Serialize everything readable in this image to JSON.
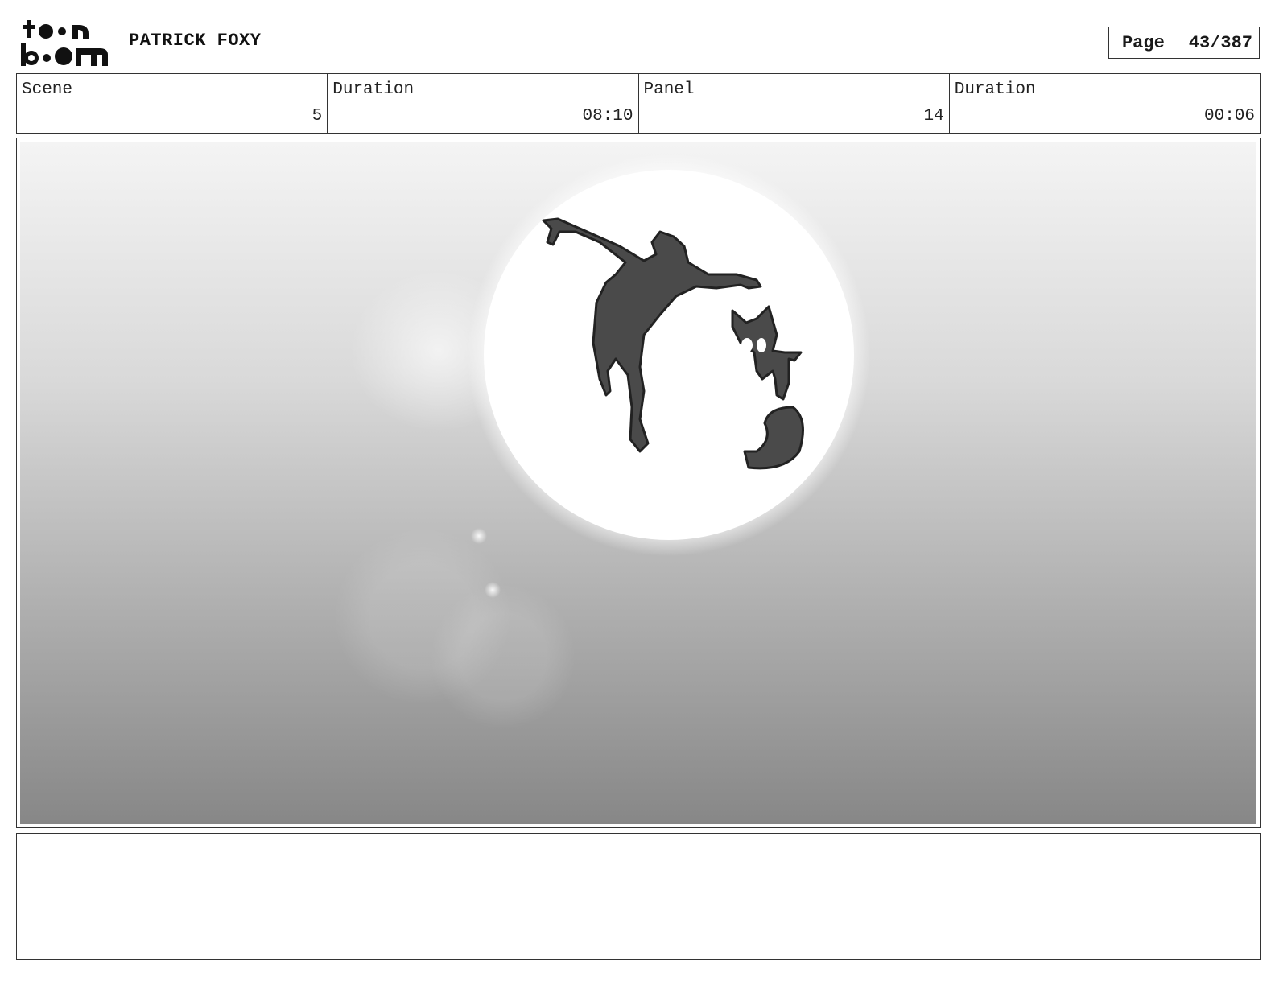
{
  "header": {
    "logo": {
      "line1": "toon",
      "line2": "boom"
    },
    "project_title": "PATRICK FOXY",
    "page_label": "Page",
    "page_value": "43/387"
  },
  "info": {
    "scene_label": "Scene",
    "scene_value": "5",
    "scene_duration_label": "Duration",
    "scene_duration_value": "08:10",
    "panel_label": "Panel",
    "panel_value": "14",
    "panel_duration_label": "Duration",
    "panel_duration_value": "00:06"
  },
  "panel": {
    "image_description": "moon-silhouette-artwork",
    "sky_top_color": "#f2f2f2",
    "sky_bottom_color": "#8a8a8a",
    "figure_color": "#4a4a4a"
  },
  "notes": {
    "text": ""
  }
}
